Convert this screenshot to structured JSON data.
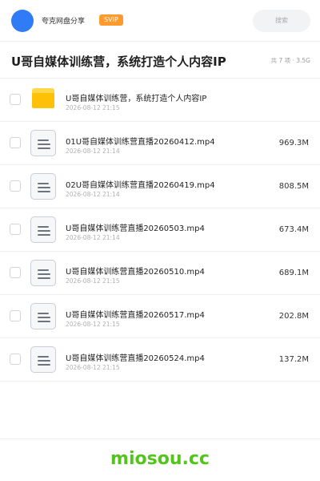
{
  "header": {
    "app_name": "夸克网盘分享",
    "badge": "SVIP",
    "search_placeholder": "搜索",
    "avatar_color": "#2f7cf6",
    "badge_color": "#ff9a2e"
  },
  "share": {
    "title": "U哥自媒体训练营，系统打造个人内容IP",
    "meta": "共 7 项 · 3.5G"
  },
  "files": [
    {
      "name": "U哥自媒体训练营，系统打造个人内容IP",
      "date": "2026-08-12 21:15",
      "size": "",
      "icon": "folder-icon"
    },
    {
      "name": "01U哥自媒体训练营直播20260412.mp4",
      "date": "2026-08-12 21:14",
      "size": "969.3M",
      "icon": "file-icon"
    },
    {
      "name": "02U哥自媒体训练营直播20260419.mp4",
      "date": "2026-08-12 21:14",
      "size": "808.5M",
      "icon": "file-icon"
    },
    {
      "name": "U哥自媒体训练营直播20260503.mp4",
      "date": "2026-08-12 21:14",
      "size": "673.4M",
      "icon": "file-icon"
    },
    {
      "name": "U哥自媒体训练营直播20260510.mp4",
      "date": "2026-08-12 21:15",
      "size": "689.1M",
      "icon": "file-icon"
    },
    {
      "name": "U哥自媒体训练营直播20260517.mp4",
      "date": "2026-08-12 21:15",
      "size": "202.8M",
      "icon": "file-icon"
    },
    {
      "name": "U哥自媒体训练营直播20260524.mp4",
      "date": "2026-08-12 21:15",
      "size": "137.2M",
      "icon": "file-icon"
    }
  ],
  "watermark": "miosou.cc",
  "watermark_color": "#52c41a"
}
